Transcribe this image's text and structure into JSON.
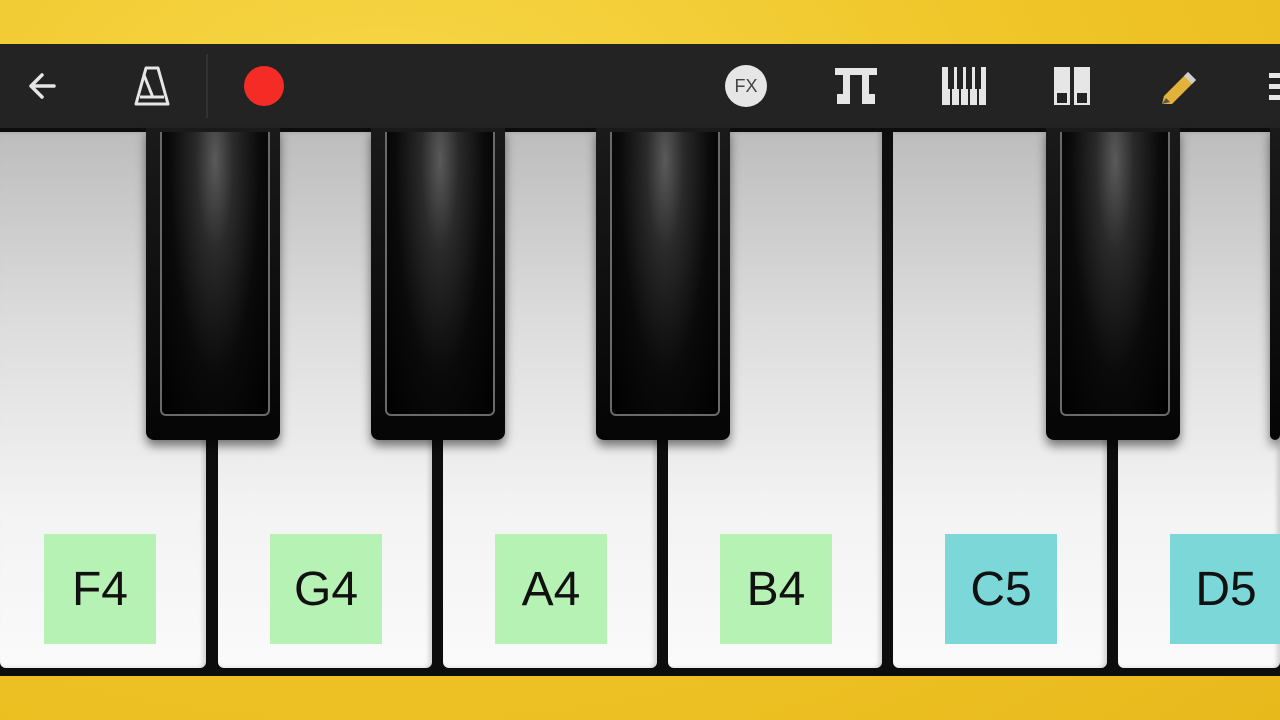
{
  "toolbar": {
    "icons": [
      "back-arrow-icon",
      "metronome-icon",
      "record-icon",
      "fx-icon",
      "piano-keys-icon",
      "keyboard-layout-icon",
      "dual-keyboard-icon",
      "pencil-icon",
      "menu-icon"
    ],
    "fx_label": "FX",
    "record_color": "#f52b26"
  },
  "keyboard": {
    "white_keys": [
      {
        "note": "F4",
        "label_color": "#b6f2b4"
      },
      {
        "note": "G4",
        "label_color": "#b6f2b4"
      },
      {
        "note": "A4",
        "label_color": "#b6f2b4"
      },
      {
        "note": "B4",
        "label_color": "#b6f2b4"
      },
      {
        "note": "C5",
        "label_color": "#7cd8d8"
      },
      {
        "note": "D5",
        "label_color": "#7cd8d8"
      }
    ]
  },
  "colors": {
    "background": "#efc426",
    "toolbar": "#232323"
  }
}
